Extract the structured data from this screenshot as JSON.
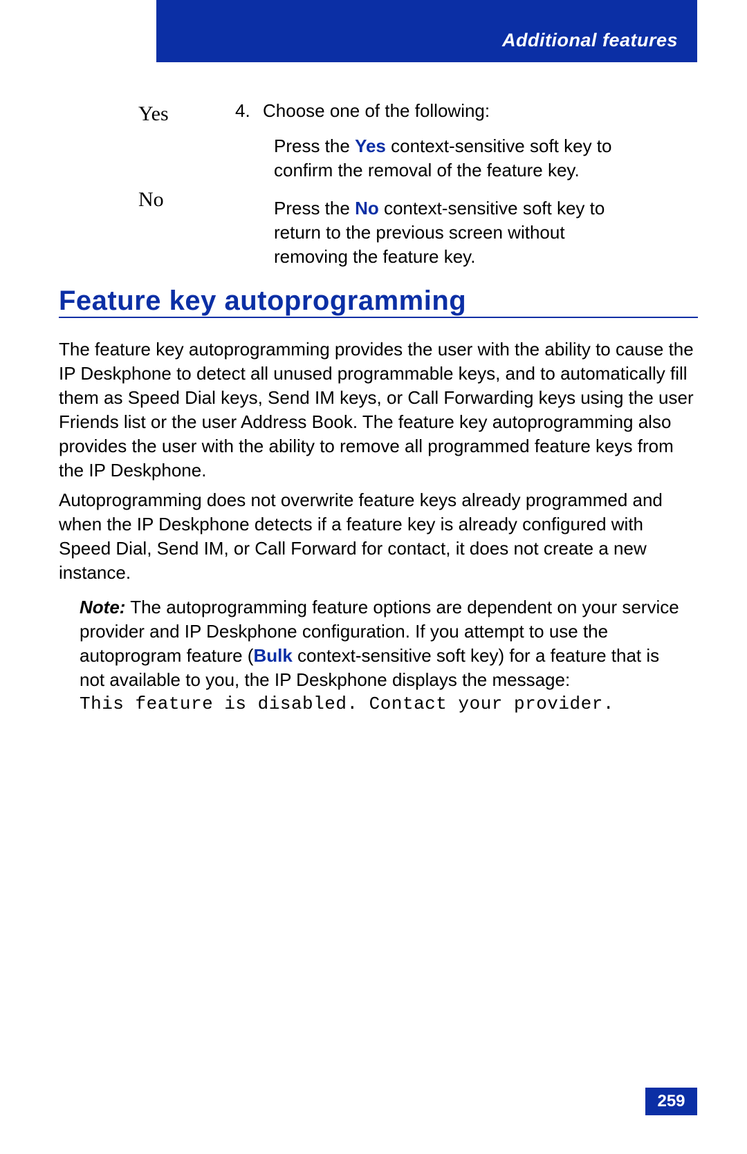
{
  "header": {
    "section_title": "Additional features"
  },
  "softkeys": {
    "yes": "Yes",
    "no": "No"
  },
  "step": {
    "number": "4.",
    "intro": "Choose one of the following:",
    "options": {
      "yes": {
        "prefix": "Press the ",
        "term": "Yes",
        "suffix": " context-sensitive soft key to confirm the removal of the feature key."
      },
      "no": {
        "prefix": "Press the ",
        "term": "No",
        "suffix": " context-sensitive soft key to return to the previous screen without removing the feature key."
      }
    }
  },
  "section_heading": "Feature key autoprogramming",
  "paragraphs": {
    "p1": "The feature key autoprogramming provides the user with the ability to cause the IP Deskphone to detect all unused programmable keys, and to automatically fill them as Speed Dial keys, Send IM keys, or Call Forwarding keys using the user Friends list or the user Address Book. The feature key autoprogramming also provides the user with the ability to remove all programmed feature keys from the IP Deskphone.",
    "p2": "Autoprogramming does not overwrite feature keys already programmed and when the IP Deskphone detects if a feature key is already configured with Speed Dial, Send IM, or Call Forward for contact, it does not create a new instance."
  },
  "note": {
    "label": "Note:",
    "before": "  The autoprogramming feature options are dependent on your service provider and IP Deskphone configuration. If you attempt to use the autoprogram feature (",
    "term": "Bulk",
    "after": " context-sensitive soft key) for a feature that is not available to you, the IP Deskphone displays the message:",
    "message": "This feature is disabled. Contact your provider."
  },
  "page_number": "259"
}
